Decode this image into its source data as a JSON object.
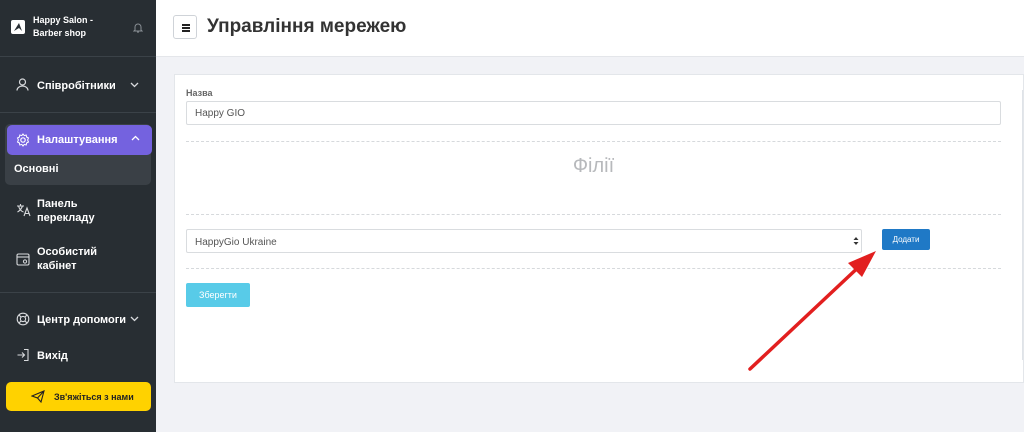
{
  "sidebar": {
    "brand_name": "Happy Salon - Barber shop",
    "items": [
      {
        "label": "Співробітники",
        "icon": "person-icon"
      },
      {
        "label": "Налаштування",
        "icon": "gear-icon"
      },
      {
        "label": "Основні"
      },
      {
        "label": "Панель перекладу",
        "icon": "translate-icon"
      },
      {
        "label": "Особистий кабінет",
        "icon": "cabinet-icon"
      },
      {
        "label": "Центр допомоги",
        "icon": "lifebuoy-icon"
      },
      {
        "label": "Вихід",
        "icon": "logout-icon"
      }
    ],
    "contact_button": "Зв'яжіться з нами",
    "colors": {
      "background": "#282e33",
      "active": "#7462df",
      "contact": "#ffd200"
    }
  },
  "header": {
    "title": "Управління мережею"
  },
  "form": {
    "name_label": "Назва",
    "name_value": "Happy GIO",
    "branches_title": "Філії",
    "branch_select_value": "HappyGio Ukraine",
    "add_button": "Додати",
    "save_button": "Зберегти",
    "colors": {
      "add": "#1f79c6",
      "save": "#58cbe8"
    }
  },
  "annotation": {
    "type": "arrow",
    "color": "#e21f1f"
  }
}
